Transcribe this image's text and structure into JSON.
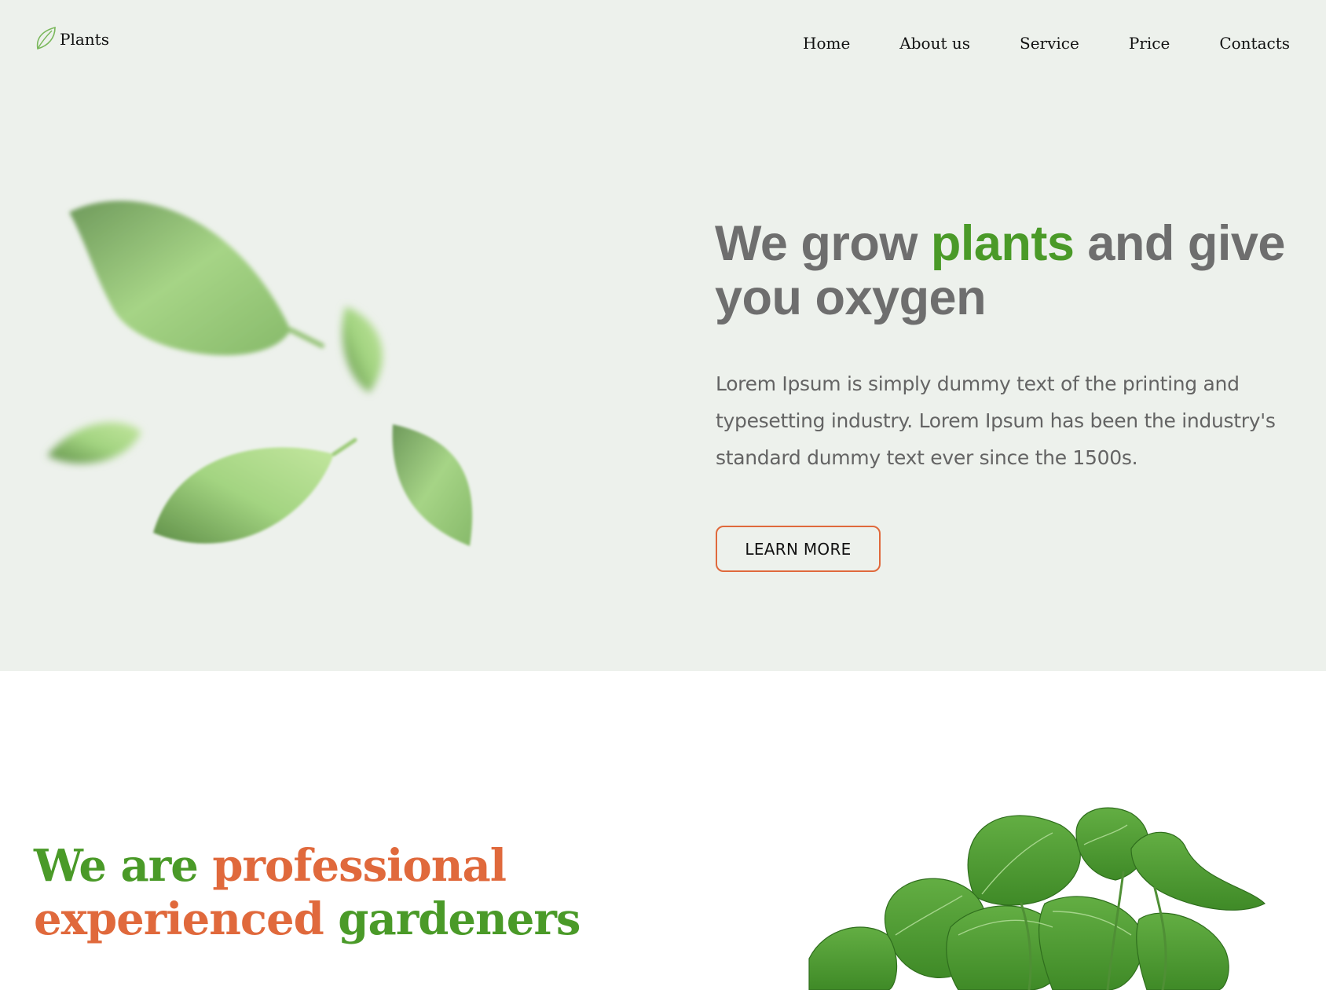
{
  "brand": {
    "name": "Plants",
    "icon": "leaf-icon"
  },
  "nav": {
    "items": [
      {
        "label": "Home"
      },
      {
        "label": "About us"
      },
      {
        "label": "Service"
      },
      {
        "label": "Price"
      },
      {
        "label": "Contacts"
      }
    ]
  },
  "hero": {
    "title_part1": "We grow ",
    "title_accent": "plants",
    "title_part2": " and give you oxygen",
    "description": "Lorem Ipsum is simply dummy text of the printing and typesetting industry. Lorem Ipsum has been the industry's standard dummy text ever since the 1500s.",
    "button_label": "LEARN MORE"
  },
  "about": {
    "title_part1": "We are ",
    "title_part2": "professional experienced",
    "title_part3": " gardeners"
  },
  "colors": {
    "hero_background": "#edf1ec",
    "accent_green": "#4a9a28",
    "accent_orange": "#e0693c",
    "heading_gray": "#6e6e6e",
    "text_gray": "#646464"
  }
}
